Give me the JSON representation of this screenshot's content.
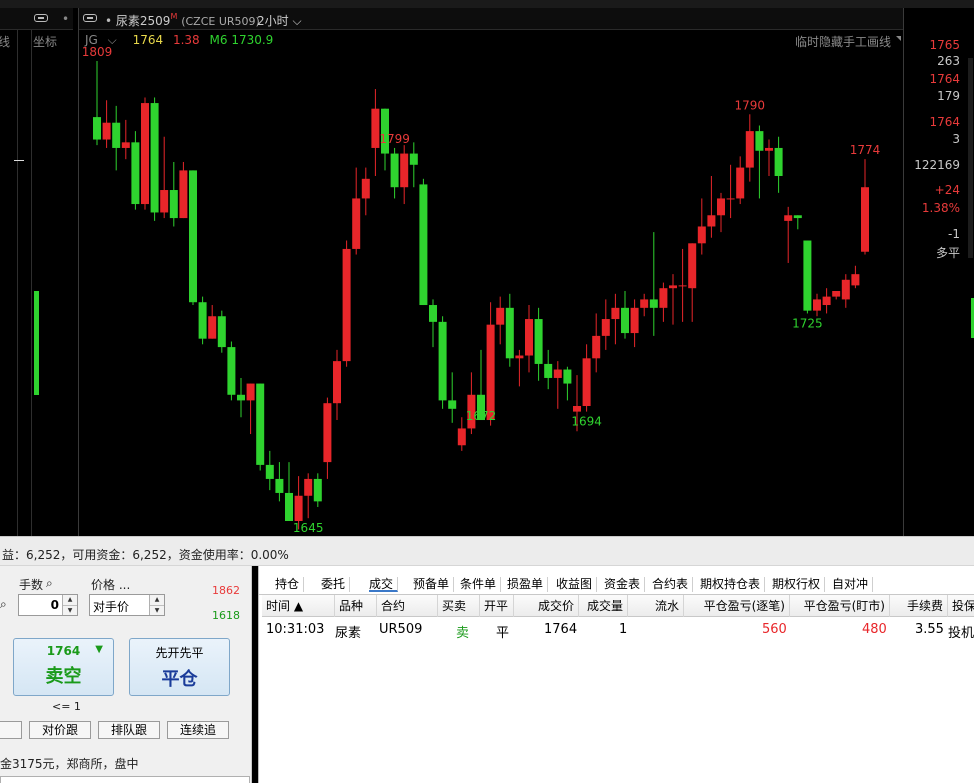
{
  "left": {
    "labels": [
      "线",
      "坐标"
    ]
  },
  "chart_tab": {
    "title": "尿素2509",
    "badge": "M",
    "code": "(CZCE UR509)",
    "period": "2小时"
  },
  "info": {
    "indicator": "JG",
    "price": "1764",
    "change": "1.38",
    "ma_label": "M6 1730.9",
    "note": "临时隐藏手工画线"
  },
  "right_values": [
    {
      "text": "1765",
      "color": "#e83a3a"
    },
    {
      "text": "263",
      "color": "#c8c8c8"
    },
    {
      "text": "1764",
      "color": "#e83a3a"
    },
    {
      "text": "179",
      "color": "#c8c8c8"
    },
    {
      "text": "1764",
      "color": "#e83a3a"
    },
    {
      "text": "3",
      "color": "#c8c8c8"
    },
    {
      "text": "122169",
      "color": "#c8c8c8"
    },
    {
      "text": "+24",
      "color": "#e83a3a"
    },
    {
      "text": "1.38%",
      "color": "#e83a3a"
    },
    {
      "text": "-1",
      "color": "#c8c8c8"
    },
    {
      "text": "多平",
      "color": "#c8c8c8"
    }
  ],
  "chart_data": {
    "type": "candlestick",
    "up_color": "#e8262a",
    "down_color": "#2fd32f",
    "annotations": [
      {
        "text": "1809",
        "color": "#e83a3a"
      },
      {
        "text": "1799",
        "color": "#e83a3a"
      },
      {
        "text": "1790",
        "color": "#e83a3a"
      },
      {
        "text": "1774",
        "color": "#e83a3a"
      },
      {
        "text": "1725",
        "color": "#2fd32f"
      },
      {
        "text": "1694",
        "color": "#2fd32f"
      },
      {
        "text": "1672",
        "color": "#2fd32f"
      },
      {
        "text": "1645",
        "color": "#2fd32f"
      }
    ],
    "candles": [
      {
        "o": 1789,
        "h": 1809,
        "l": 1779,
        "c": 1781
      },
      {
        "o": 1781,
        "h": 1795,
        "l": 1778,
        "c": 1787
      },
      {
        "o": 1787,
        "h": 1793,
        "l": 1770,
        "c": 1778
      },
      {
        "o": 1778,
        "h": 1788,
        "l": 1774,
        "c": 1780
      },
      {
        "o": 1780,
        "h": 1784,
        "l": 1756,
        "c": 1758
      },
      {
        "o": 1758,
        "h": 1796,
        "l": 1756,
        "c": 1794
      },
      {
        "o": 1794,
        "h": 1796,
        "l": 1752,
        "c": 1755
      },
      {
        "o": 1755,
        "h": 1782,
        "l": 1753,
        "c": 1763
      },
      {
        "o": 1763,
        "h": 1773,
        "l": 1750,
        "c": 1753
      },
      {
        "o": 1753,
        "h": 1773,
        "l": 1755,
        "c": 1770
      },
      {
        "o": 1770,
        "h": 1770,
        "l": 1722,
        "c": 1723
      },
      {
        "o": 1723,
        "h": 1725,
        "l": 1708,
        "c": 1710
      },
      {
        "o": 1710,
        "h": 1722,
        "l": 1710,
        "c": 1718
      },
      {
        "o": 1718,
        "h": 1720,
        "l": 1705,
        "c": 1707
      },
      {
        "o": 1707,
        "h": 1709,
        "l": 1688,
        "c": 1690
      },
      {
        "o": 1690,
        "h": 1696,
        "l": 1682,
        "c": 1688
      },
      {
        "o": 1688,
        "h": 1694,
        "l": 1676,
        "c": 1694
      },
      {
        "o": 1694,
        "h": 1694,
        "l": 1663,
        "c": 1665
      },
      {
        "o": 1665,
        "h": 1670,
        "l": 1656,
        "c": 1660
      },
      {
        "o": 1660,
        "h": 1666,
        "l": 1652,
        "c": 1655
      },
      {
        "o": 1655,
        "h": 1666,
        "l": 1650,
        "c": 1645
      },
      {
        "o": 1645,
        "h": 1661,
        "l": 1642,
        "c": 1654
      },
      {
        "o": 1654,
        "h": 1662,
        "l": 1646,
        "c": 1660
      },
      {
        "o": 1660,
        "h": 1662,
        "l": 1650,
        "c": 1652
      },
      {
        "o": 1666,
        "h": 1689,
        "l": 1660,
        "c": 1687
      },
      {
        "o": 1687,
        "h": 1706,
        "l": 1681,
        "c": 1702
      },
      {
        "o": 1702,
        "h": 1745,
        "l": 1700,
        "c": 1742
      },
      {
        "o": 1742,
        "h": 1771,
        "l": 1740,
        "c": 1760
      },
      {
        "o": 1760,
        "h": 1771,
        "l": 1754,
        "c": 1767
      },
      {
        "o": 1778,
        "h": 1799,
        "l": 1768,
        "c": 1792
      },
      {
        "o": 1792,
        "h": 1790,
        "l": 1770,
        "c": 1776
      },
      {
        "o": 1776,
        "h": 1778,
        "l": 1760,
        "c": 1764
      },
      {
        "o": 1764,
        "h": 1779,
        "l": 1758,
        "c": 1776
      },
      {
        "o": 1776,
        "h": 1780,
        "l": 1764,
        "c": 1772
      },
      {
        "o": 1765,
        "h": 1767,
        "l": 1722,
        "c": 1722
      },
      {
        "o": 1722,
        "h": 1724,
        "l": 1707,
        "c": 1716
      },
      {
        "o": 1716,
        "h": 1718,
        "l": 1685,
        "c": 1688
      },
      {
        "o": 1688,
        "h": 1698,
        "l": 1680,
        "c": 1685
      },
      {
        "o": 1672,
        "h": 1682,
        "l": 1670,
        "c": 1678
      },
      {
        "o": 1678,
        "h": 1698,
        "l": 1676,
        "c": 1690
      },
      {
        "o": 1690,
        "h": 1706,
        "l": 1686,
        "c": 1681
      },
      {
        "o": 1681,
        "h": 1723,
        "l": 1679,
        "c": 1715
      },
      {
        "o": 1715,
        "h": 1725,
        "l": 1708,
        "c": 1721
      },
      {
        "o": 1721,
        "h": 1726,
        "l": 1700,
        "c": 1703
      },
      {
        "o": 1703,
        "h": 1706,
        "l": 1693,
        "c": 1704
      },
      {
        "o": 1704,
        "h": 1722,
        "l": 1698,
        "c": 1717
      },
      {
        "o": 1717,
        "h": 1721,
        "l": 1695,
        "c": 1701
      },
      {
        "o": 1701,
        "h": 1706,
        "l": 1692,
        "c": 1696
      },
      {
        "o": 1696,
        "h": 1702,
        "l": 1685,
        "c": 1699
      },
      {
        "o": 1699,
        "h": 1700,
        "l": 1688,
        "c": 1694
      },
      {
        "o": 1684,
        "h": 1697,
        "l": 1677,
        "c": 1686
      },
      {
        "o": 1686,
        "h": 1708,
        "l": 1684,
        "c": 1703
      },
      {
        "o": 1703,
        "h": 1719,
        "l": 1698,
        "c": 1711
      },
      {
        "o": 1711,
        "h": 1724,
        "l": 1706,
        "c": 1717
      },
      {
        "o": 1717,
        "h": 1726,
        "l": 1708,
        "c": 1721
      },
      {
        "o": 1721,
        "h": 1727,
        "l": 1710,
        "c": 1712
      },
      {
        "o": 1712,
        "h": 1724,
        "l": 1707,
        "c": 1721
      },
      {
        "o": 1721,
        "h": 1726,
        "l": 1718,
        "c": 1724
      },
      {
        "o": 1724,
        "h": 1748,
        "l": 1711,
        "c": 1721
      },
      {
        "o": 1721,
        "h": 1730,
        "l": 1716,
        "c": 1728
      },
      {
        "o": 1728,
        "h": 1733,
        "l": 1715,
        "c": 1729
      },
      {
        "o": 1729,
        "h": 1742,
        "l": 1716,
        "c": 1729
      },
      {
        "o": 1728,
        "h": 1744,
        "l": 1716,
        "c": 1744
      },
      {
        "o": 1744,
        "h": 1760,
        "l": 1740,
        "c": 1750
      },
      {
        "o": 1750,
        "h": 1768,
        "l": 1746,
        "c": 1754
      },
      {
        "o": 1754,
        "h": 1762,
        "l": 1748,
        "c": 1760
      },
      {
        "o": 1760,
        "h": 1772,
        "l": 1753,
        "c": 1760
      },
      {
        "o": 1760,
        "h": 1775,
        "l": 1758,
        "c": 1771
      },
      {
        "o": 1771,
        "h": 1790,
        "l": 1766,
        "c": 1784
      },
      {
        "o": 1784,
        "h": 1786,
        "l": 1760,
        "c": 1777
      },
      {
        "o": 1777,
        "h": 1781,
        "l": 1768,
        "c": 1778
      },
      {
        "o": 1778,
        "h": 1782,
        "l": 1762,
        "c": 1768
      },
      {
        "o": 1752,
        "h": 1757,
        "l": 1737,
        "c": 1754
      },
      {
        "o": 1754,
        "h": 1754,
        "l": 1749,
        "c": 1753
      },
      {
        "o": 1745,
        "h": 1745,
        "l": 1719,
        "c": 1720
      },
      {
        "o": 1720,
        "h": 1726,
        "l": 1718,
        "c": 1724
      },
      {
        "o": 1722,
        "h": 1728,
        "l": 1719,
        "c": 1725
      },
      {
        "o": 1725,
        "h": 1726,
        "l": 1724,
        "c": 1727
      },
      {
        "o": 1724,
        "h": 1733,
        "l": 1721,
        "c": 1731
      },
      {
        "o": 1729,
        "h": 1736,
        "l": 1728,
        "c": 1733
      },
      {
        "o": 1741,
        "h": 1774,
        "l": 1740,
        "c": 1764
      }
    ]
  },
  "status": "益：6,252，可用资金：6,252，资金使用率：0.00%",
  "order": {
    "qty_label": "手数",
    "qty_value": "0",
    "price_label": "价格 ...",
    "price_value": "对手价",
    "limit_up": "1862",
    "limit_down": "1618",
    "sell_price": "1764",
    "sell_label": "卖空",
    "close_top": "先开先平",
    "close_label": "平仓",
    "le_hint": "<= 1",
    "buttons": [
      "对价跟",
      "排队跟",
      "连续追"
    ],
    "info": "金3175元，郑商所，盘中"
  },
  "records": {
    "tabs": [
      "持仓",
      "委托",
      "成交",
      "预备单",
      "条件单",
      "损盈单",
      "收益图",
      "资金表",
      "合约表",
      "期权持仓表",
      "期权行权",
      "自对冲"
    ],
    "active_tab": "成交",
    "headers": [
      "时间 ▲",
      "品种",
      "合约",
      "买卖",
      "开平",
      "成交价",
      "成交量",
      "流水",
      "平仓盈亏(逐笔)",
      "平仓盈亏(盯市)",
      "手续费",
      "投保"
    ],
    "row": {
      "time": "10:31:03",
      "product": "尿素",
      "contract": "UR509",
      "side": "卖",
      "offset": "平",
      "price": "1764",
      "volume": "1",
      "serial": "",
      "pnl_trade": "560",
      "pnl_mtm": "480",
      "fee": "3.55",
      "hedge": "投机"
    }
  }
}
